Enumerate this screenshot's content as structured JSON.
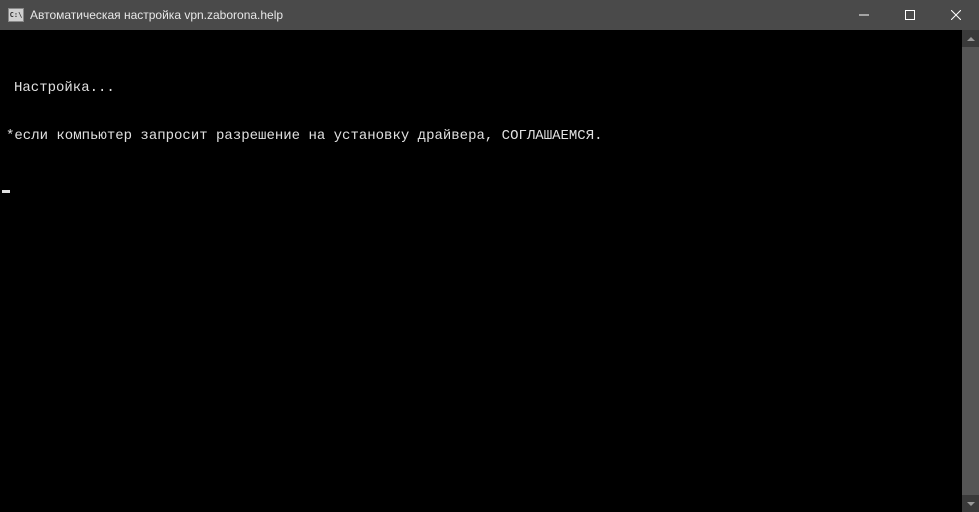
{
  "window": {
    "title": "Автоматическая настройка vpn.zaborona.help",
    "icon_glyph": "C:\\"
  },
  "terminal": {
    "line1": "Настройка...",
    "line2": "*если компьютер запросит разрешение на установку драйвера, СОГЛАШАЕМСЯ."
  }
}
